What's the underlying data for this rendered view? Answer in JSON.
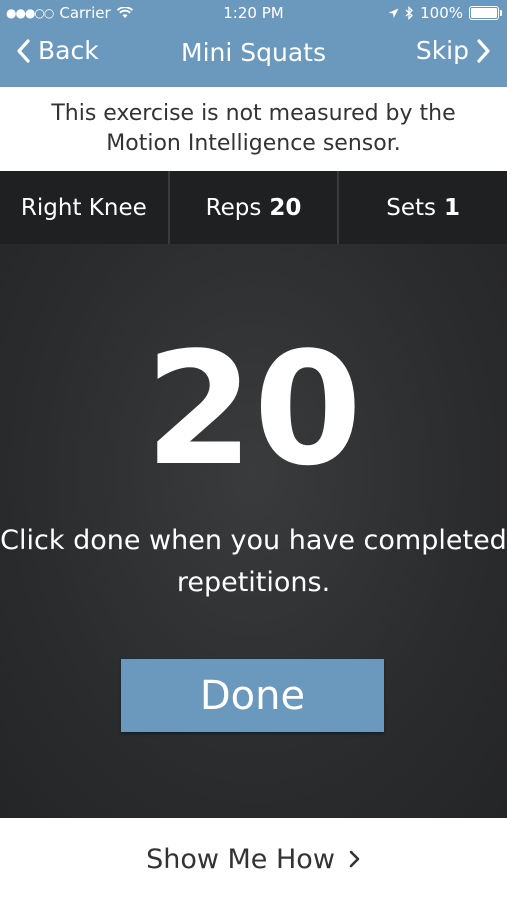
{
  "status_bar": {
    "carrier": "Carrier",
    "time": "1:20 PM",
    "battery": "100%"
  },
  "nav": {
    "back_label": "Back",
    "title": "Mini Squats",
    "skip_label": "Skip"
  },
  "notice": "This exercise is not measured by the Motion Intelligence sensor.",
  "stats": {
    "side": "Right Knee",
    "reps_label": "Reps",
    "reps_value": "20",
    "sets_label": "Sets",
    "sets_value": "1"
  },
  "counter": {
    "value": "20",
    "instruction": "Click done when you have completed repetitions."
  },
  "done_label": "Done",
  "footer": {
    "show_me_how": "Show Me How"
  },
  "colors": {
    "header_bg": "#6b98bd",
    "button_bg": "#6b98bd",
    "stats_bg": "#1f2021",
    "main_bg": "#2b2c2e"
  }
}
